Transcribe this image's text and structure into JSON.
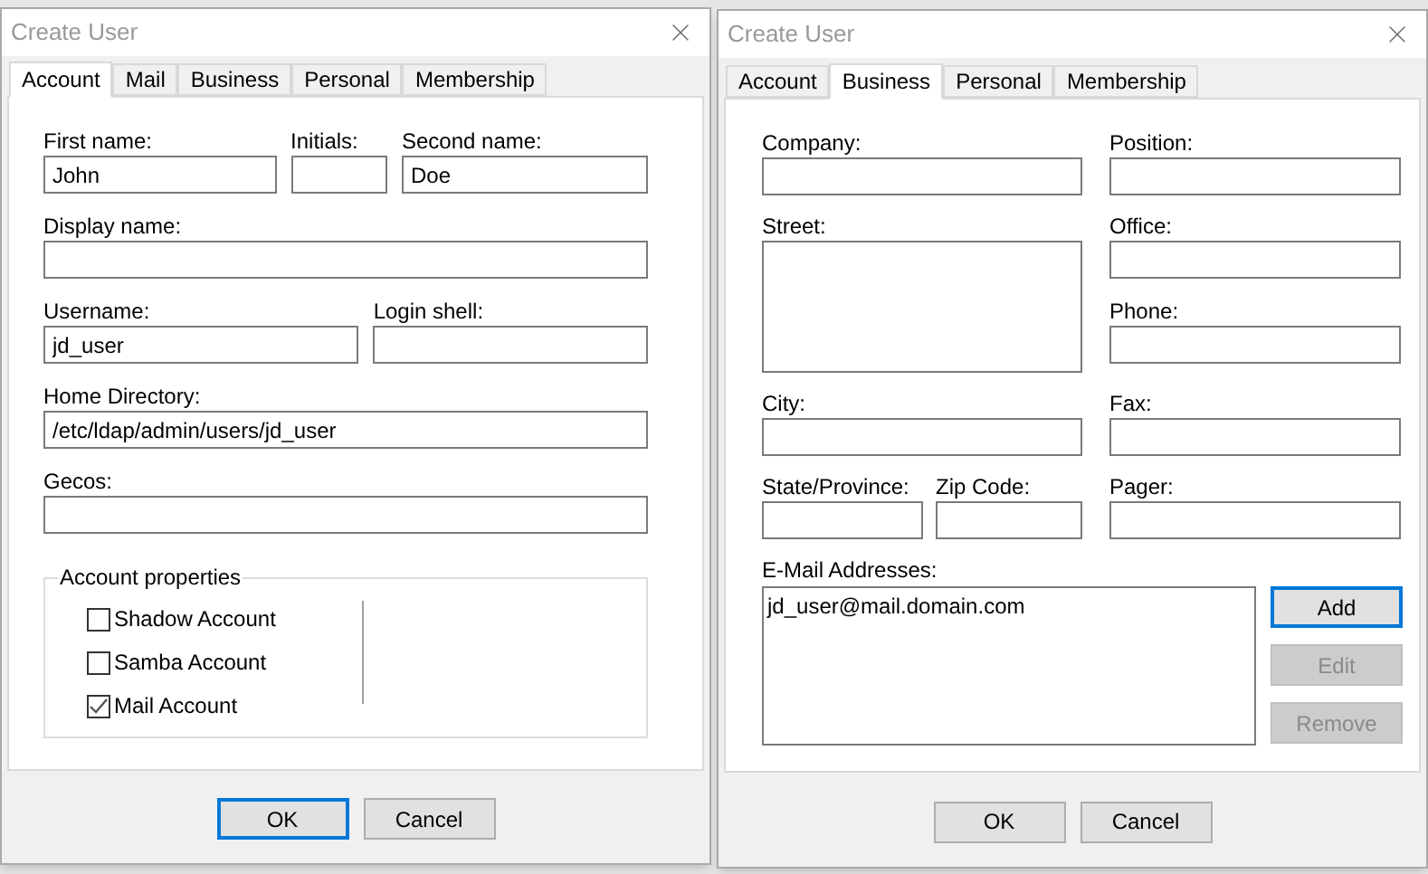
{
  "windows": [
    {
      "kind": "account",
      "title": "Create User",
      "tabs": [
        {
          "label": "Account",
          "selected": true
        },
        {
          "label": "Mail",
          "selected": false
        },
        {
          "label": "Business",
          "selected": false
        },
        {
          "label": "Personal",
          "selected": false
        },
        {
          "label": "Membership",
          "selected": false
        }
      ],
      "fields": [
        {
          "label": "First name:",
          "value": "John"
        },
        {
          "label": "Initials:"
        },
        {
          "label": "Second name:",
          "value": "Doe"
        },
        {
          "label": "Display name:"
        },
        {
          "label": "Username:",
          "value": "jd_user"
        },
        {
          "label": "Login shell:"
        },
        {
          "label": "Home Directory:",
          "value": "/etc/ldap/admin/users/jd_user"
        },
        {
          "label": "Gecos:"
        }
      ],
      "group": {
        "title": "Account properties",
        "checkboxes": [
          {
            "label": "Shadow Account",
            "checked": false
          },
          {
            "label": "Samba Account",
            "checked": false
          },
          {
            "label": "Mail Account",
            "checked": true
          }
        ]
      },
      "buttons": [
        {
          "label": "OK",
          "focused": true
        },
        {
          "label": "Cancel",
          "focused": false
        }
      ]
    },
    {
      "kind": "business",
      "title": "Create User",
      "tabs": [
        {
          "label": "Account",
          "selected": false
        },
        {
          "label": "Business",
          "selected": true
        },
        {
          "label": "Personal",
          "selected": false
        },
        {
          "label": "Membership",
          "selected": false
        }
      ],
      "fields": [
        {
          "label": "Company:"
        },
        {
          "label": "Position:"
        },
        {
          "label": "Street:"
        },
        {
          "label": "Office:"
        },
        {
          "label": "Phone:"
        },
        {
          "label": "City:"
        },
        {
          "label": "Fax:"
        },
        {
          "label": "State/Province:"
        },
        {
          "label": "Zip Code:"
        },
        {
          "label": "Pager:"
        }
      ],
      "email": {
        "label": "E-Mail Addresses:",
        "items": [
          "jd_user@mail.domain.com"
        ],
        "buttons": [
          {
            "label": "Add",
            "focused": true,
            "disabled": false
          },
          {
            "label": "Edit",
            "focused": false,
            "disabled": true
          },
          {
            "label": "Remove",
            "focused": false,
            "disabled": true
          }
        ]
      },
      "buttons": [
        {
          "label": "OK",
          "focused": false
        },
        {
          "label": "Cancel",
          "focused": false
        }
      ]
    }
  ]
}
